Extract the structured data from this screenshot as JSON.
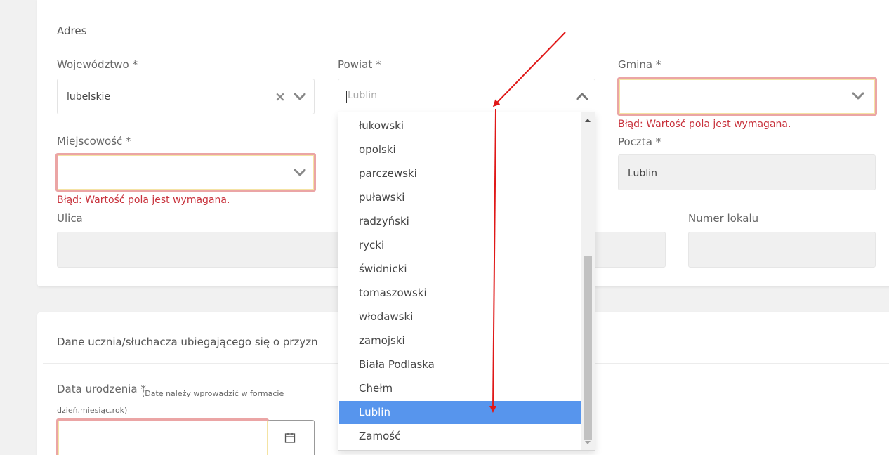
{
  "address": {
    "section_title": "Adres",
    "wojewodztwo": {
      "label": "Województwo *",
      "value": "lubelskie"
    },
    "powiat": {
      "label": "Powiat *",
      "value": "Lublin"
    },
    "gmina": {
      "label": "Gmina *",
      "value": "",
      "error": "Błąd: Wartość pola jest wymagana."
    },
    "miejscowosc": {
      "label": "Miejscowość *",
      "value": "",
      "error": "Błąd: Wartość pola jest wymagana."
    },
    "poczta": {
      "label": "Poczta *",
      "value": "Lublin"
    },
    "ulica": {
      "label": "Ulica",
      "value": ""
    },
    "numer_lokalu": {
      "label": "Numer lokalu",
      "value": ""
    }
  },
  "student": {
    "section_title": "Dane ucznia/słuchacza ubiegającego się o przyzn",
    "birth_date": {
      "label": "Data urodzenia *",
      "hint": "(Datę należy wprowadzić w formacie dzień.miesiąc.rok)",
      "value": ""
    }
  },
  "dropdown": {
    "options": [
      "łukowski",
      "opolski",
      "parczewski",
      "puławski",
      "radzyński",
      "rycki",
      "świdnicki",
      "tomaszowski",
      "włodawski",
      "zamojski",
      "Biała Podlaska",
      "Chełm",
      "Lublin",
      "Zamość"
    ],
    "selected_index": 12,
    "scroll_fraction": 1.0
  },
  "colors": {
    "error_text": "#c8323c",
    "error_border": "#eba5a5",
    "selected_option": "#5795ed",
    "annotation_arrow": "#e01818"
  },
  "icons": {
    "select_chevron": "chevron-down-icon",
    "open_chevron": "chevron-up-icon",
    "clear": "clear-x-icon",
    "calendar": "calendar-icon"
  }
}
